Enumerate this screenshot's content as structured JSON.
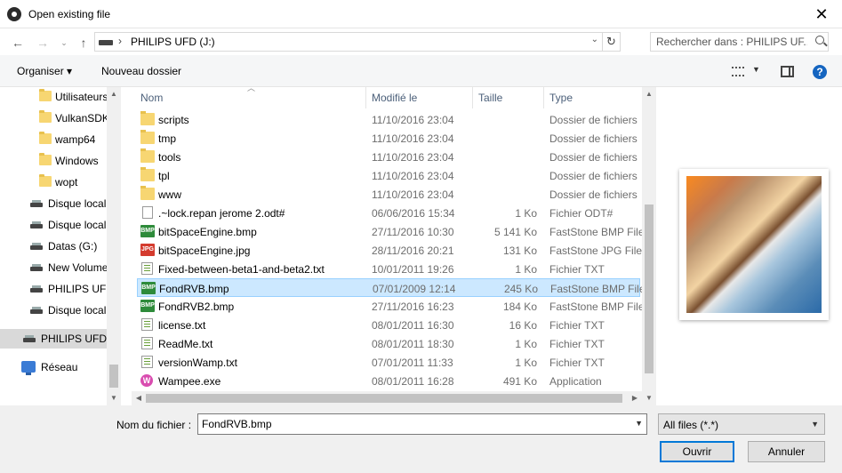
{
  "window": {
    "title": "Open existing file",
    "close_label": "✕"
  },
  "address": {
    "path": "PHILIPS UFD (J:)",
    "separator": "›",
    "search_placeholder": "Rechercher dans : PHILIPS UF..."
  },
  "toolbar": {
    "organiser_label": "Organiser ▾",
    "new_folder_label": "Nouveau dossier",
    "help_label": "?"
  },
  "sidebar": {
    "items": [
      {
        "label": "Utilisateurs",
        "icon": "folder"
      },
      {
        "label": "VulkanSDK",
        "icon": "folder"
      },
      {
        "label": "wamp64",
        "icon": "folder"
      },
      {
        "label": "Windows",
        "icon": "folder"
      },
      {
        "label": "wopt",
        "icon": "folder"
      },
      {
        "label": "Disque local",
        "icon": "drive"
      },
      {
        "label": "Disque local",
        "icon": "drive"
      },
      {
        "label": "Datas (G:)",
        "icon": "drive"
      },
      {
        "label": "New Volume",
        "icon": "drive"
      },
      {
        "label": "PHILIPS UFD",
        "icon": "drive"
      },
      {
        "label": "Disque local",
        "icon": "drive"
      },
      {
        "label": "PHILIPS UFD (",
        "icon": "drive"
      },
      {
        "label": "Réseau",
        "icon": "network"
      }
    ]
  },
  "columns": {
    "name": "Nom",
    "modified": "Modifié le",
    "size": "Taille",
    "type": "Type"
  },
  "files": [
    {
      "name": "scripts",
      "date": "11/10/2016 23:04",
      "size": "",
      "type": "Dossier de fichiers",
      "icon": "folder",
      "icon_text": ""
    },
    {
      "name": "tmp",
      "date": "11/10/2016 23:04",
      "size": "",
      "type": "Dossier de fichiers",
      "icon": "folder",
      "icon_text": ""
    },
    {
      "name": "tools",
      "date": "11/10/2016 23:04",
      "size": "",
      "type": "Dossier de fichiers",
      "icon": "folder",
      "icon_text": ""
    },
    {
      "name": "tpl",
      "date": "11/10/2016 23:04",
      "size": "",
      "type": "Dossier de fichiers",
      "icon": "folder",
      "icon_text": ""
    },
    {
      "name": "www",
      "date": "11/10/2016 23:04",
      "size": "",
      "type": "Dossier de fichiers",
      "icon": "folder",
      "icon_text": ""
    },
    {
      "name": ".~lock.repan jerome 2.odt#",
      "date": "06/06/2016 15:34",
      "size": "1 Ko",
      "type": "Fichier ODT#",
      "icon": "doc",
      "icon_text": ""
    },
    {
      "name": "bitSpaceEngine.bmp",
      "date": "27/11/2016 10:30",
      "size": "5 141 Ko",
      "type": "FastStone BMP File",
      "icon": "bmp",
      "icon_text": "BMP"
    },
    {
      "name": "bitSpaceEngine.jpg",
      "date": "28/11/2016 20:21",
      "size": "131 Ko",
      "type": "FastStone JPG File",
      "icon": "jpg",
      "icon_text": "JPG"
    },
    {
      "name": "Fixed-between-beta1-and-beta2.txt",
      "date": "10/01/2011 19:26",
      "size": "1 Ko",
      "type": "Fichier TXT",
      "icon": "txt",
      "icon_text": ""
    },
    {
      "name": "FondRVB.bmp",
      "date": "07/01/2009 12:14",
      "size": "245 Ko",
      "type": "FastStone BMP File",
      "icon": "bmp",
      "icon_text": "BMP",
      "selected": true
    },
    {
      "name": "FondRVB2.bmp",
      "date": "27/11/2016 16:23",
      "size": "184 Ko",
      "type": "FastStone BMP File",
      "icon": "bmp",
      "icon_text": "BMP"
    },
    {
      "name": "license.txt",
      "date": "08/01/2011 16:30",
      "size": "16 Ko",
      "type": "Fichier TXT",
      "icon": "txt",
      "icon_text": ""
    },
    {
      "name": "ReadMe.txt",
      "date": "08/01/2011 18:30",
      "size": "1 Ko",
      "type": "Fichier TXT",
      "icon": "txt",
      "icon_text": ""
    },
    {
      "name": "versionWamp.txt",
      "date": "07/01/2011 11:33",
      "size": "1 Ko",
      "type": "Fichier TXT",
      "icon": "txt",
      "icon_text": ""
    },
    {
      "name": "Wampee.exe",
      "date": "08/01/2011 16:28",
      "size": "491 Ko",
      "type": "Application",
      "icon": "exe",
      "icon_text": "W"
    }
  ],
  "bottom": {
    "filename_label": "Nom du fichier :",
    "filename_value": "FondRVB.bmp",
    "filter_value": "All files (*.*)",
    "open_label": "Ouvrir",
    "cancel_label": "Annuler"
  },
  "colors": {
    "selection": "#cce8ff",
    "accent": "#0078d7",
    "header_text": "#4c607a"
  }
}
